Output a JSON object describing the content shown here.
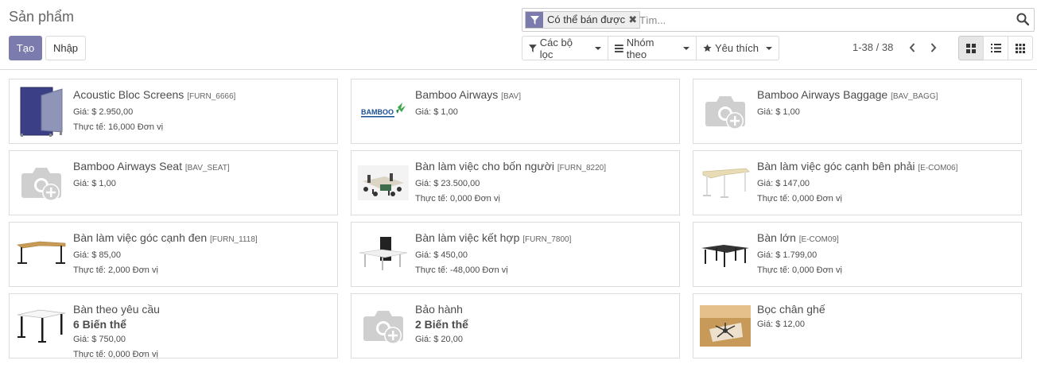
{
  "header": {
    "title": "Sản phẩm",
    "create_label": "Tạo",
    "import_label": "Nhập"
  },
  "search": {
    "facet_label": "Có thể bán được",
    "placeholder": "Tìm..."
  },
  "filters": {
    "filter_label": "Các bộ lọc",
    "group_label": "Nhóm theo",
    "favorites_label": "Yêu thích"
  },
  "pager": {
    "value": "1-38 / 38"
  },
  "colors": {
    "brand": "#7c7bad",
    "border": "#dcdcdc"
  },
  "products": [
    {
      "name": "Acoustic Bloc Screens",
      "code": "[FURN_6666]",
      "variants": "",
      "price": "Giá: $ 2.950,00",
      "qty": "Thực tế: 16,000 Đơn vị",
      "image": "acoustic-screen"
    },
    {
      "name": "Bamboo Airways",
      "code": "[BAV]",
      "variants": "",
      "price": "Giá: $ 1,00",
      "qty": "",
      "image": "bamboo-logo",
      "logo_text": "BAMBOO"
    },
    {
      "name": "Bamboo Airways Baggage",
      "code": "[BAV_BAGG]",
      "variants": "",
      "price": "Giá: $ 1,00",
      "qty": "",
      "image": "camera-placeholder"
    },
    {
      "name": "Bamboo Airways Seat",
      "code": "[BAV_SEAT]",
      "variants": "",
      "price": "Giá: $ 1,00",
      "qty": "",
      "image": "camera-placeholder"
    },
    {
      "name": "Bàn làm việc cho bốn người",
      "code": "[FURN_8220]",
      "variants": "",
      "price": "Giá: $ 23.500,00",
      "qty": "Thực tế: 0,000 Đơn vị",
      "image": "office-cluster"
    },
    {
      "name": "Bàn làm việc góc cạnh bên phải",
      "code": "[E-COM06]",
      "variants": "",
      "price": "Giá: $ 147,00",
      "qty": "Thực tế: 0,000 Đơn vị",
      "image": "corner-desk-light"
    },
    {
      "name": "Bàn làm việc góc cạnh đen",
      "code": "[FURN_1118]",
      "variants": "",
      "price": "Giá: $ 85,00",
      "qty": "Thực tế: 2,000 Đơn vị",
      "image": "corner-desk-black"
    },
    {
      "name": "Bàn làm việc kết hợp",
      "code": "[FURN_7800]",
      "variants": "",
      "price": "Giá: $ 450,00",
      "qty": "Thực tế: -48,000 Đơn vị",
      "image": "combo-desk"
    },
    {
      "name": "Bàn lớn",
      "code": "[E-COM09]",
      "variants": "",
      "price": "Giá: $ 1.799,00",
      "qty": "Thực tế: 0,000 Đơn vị",
      "image": "large-desk"
    },
    {
      "name": "Bàn theo yêu cầu",
      "code": "",
      "variants": "6 Biến thể",
      "price": "Giá: $ 750,00",
      "qty": "Thực tế: 0,000 Đơn vị",
      "image": "custom-desk"
    },
    {
      "name": "Bảo hành",
      "code": "",
      "variants": "2 Biến thể",
      "price": "Giá: $ 20,00",
      "qty": "",
      "image": "camera-placeholder"
    },
    {
      "name": "Bọc chân ghế",
      "code": "",
      "variants": "",
      "price": "Giá: $ 12,00",
      "qty": "",
      "image": "chair-base"
    }
  ]
}
